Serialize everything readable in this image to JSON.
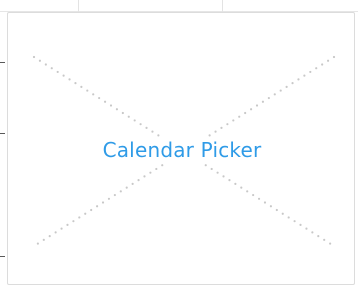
{
  "placeholder": {
    "label": "Calendar Picker",
    "label_color": "#2f9be7",
    "dot_color": "#c8c8c8",
    "border_color": "#dcdcdc"
  }
}
